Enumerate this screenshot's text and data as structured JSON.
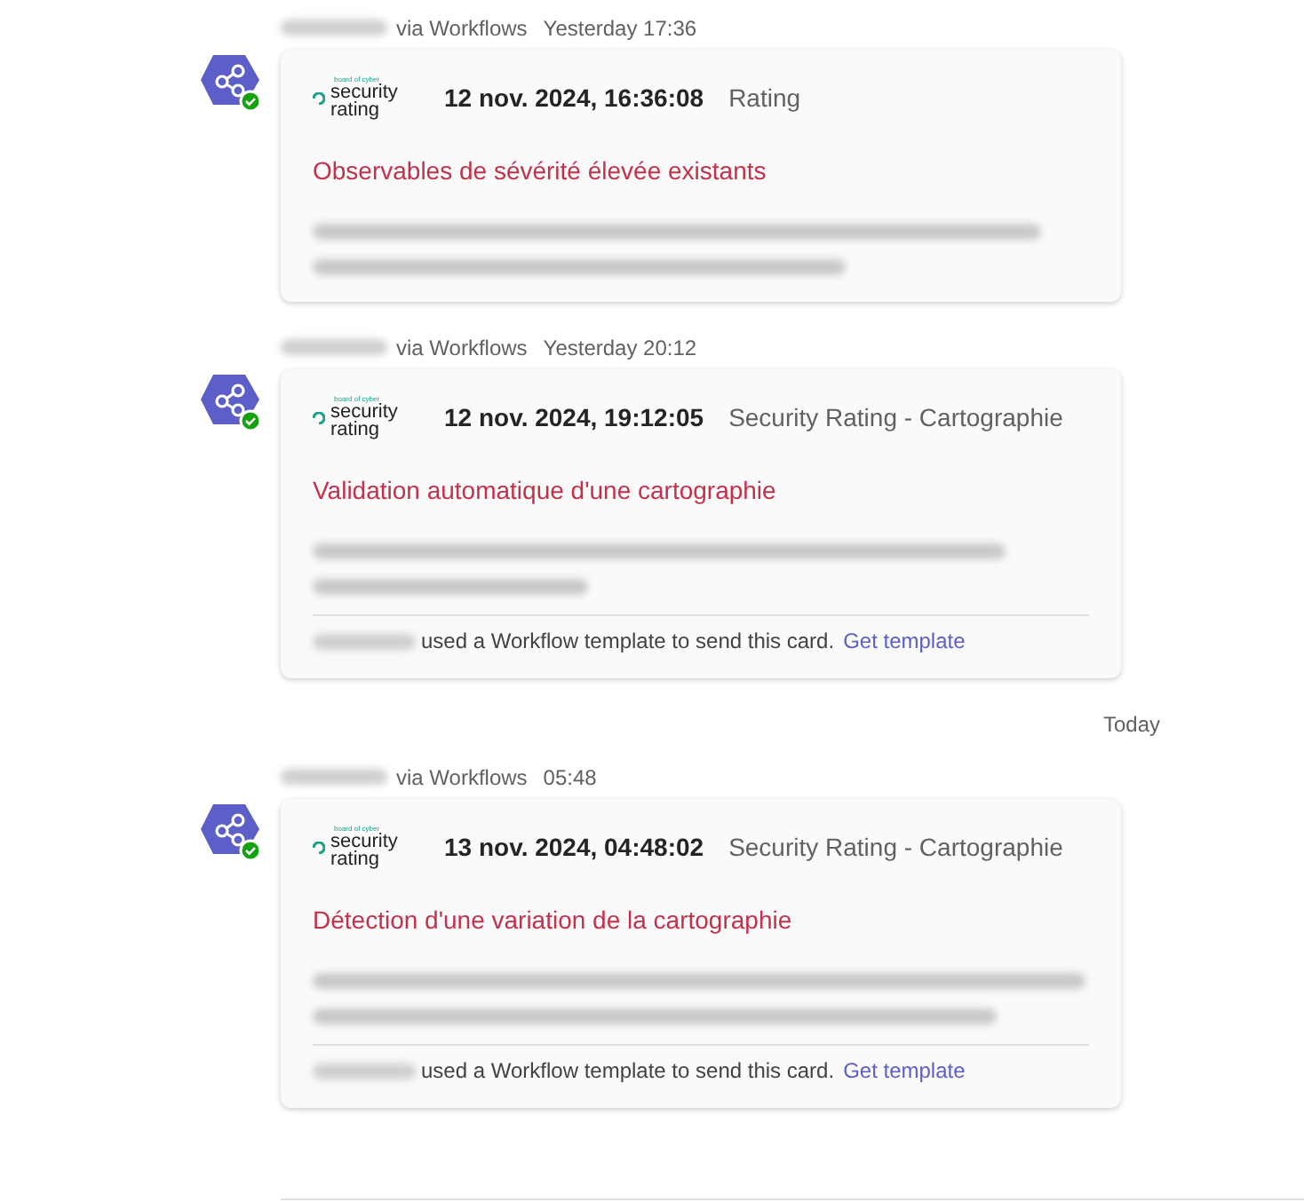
{
  "messages": [
    {
      "via": "via Workflows",
      "time": "Yesterday 17:36",
      "logo": {
        "tagline": "board of cyber",
        "line1": "security",
        "line2": "rating"
      },
      "date": "12 nov. 2024, 16:36:08",
      "category": "Rating",
      "title": "Observables de sévérité élevée existants",
      "body": {
        "kind": "blurred"
      }
    },
    {
      "via": "via Workflows",
      "time": "Yesterday 20:12",
      "logo": {
        "tagline": "board of cyber",
        "line1": "security",
        "line2": "rating"
      },
      "date": "12 nov. 2024, 19:12:05",
      "category": "Security Rating - Cartographie",
      "title": "Validation automatique d'une cartographie",
      "body": {
        "kind": "blurred"
      },
      "footer": {
        "text": "used a Workflow template to send this card.",
        "link": "Get template"
      }
    },
    {
      "divider": "Today",
      "via": "via Workflows",
      "time": "05:48",
      "logo": {
        "tagline": "board of cyber",
        "line1": "security",
        "line2": "rating"
      },
      "date": "13 nov. 2024, 04:48:02",
      "category": "Security Rating - Cartographie",
      "title": "Détection d'une variation de la cartographie",
      "body": {
        "kind": "blurred"
      },
      "footer": {
        "text": "used a Workflow template to send this card.",
        "link": "Get template"
      }
    }
  ]
}
